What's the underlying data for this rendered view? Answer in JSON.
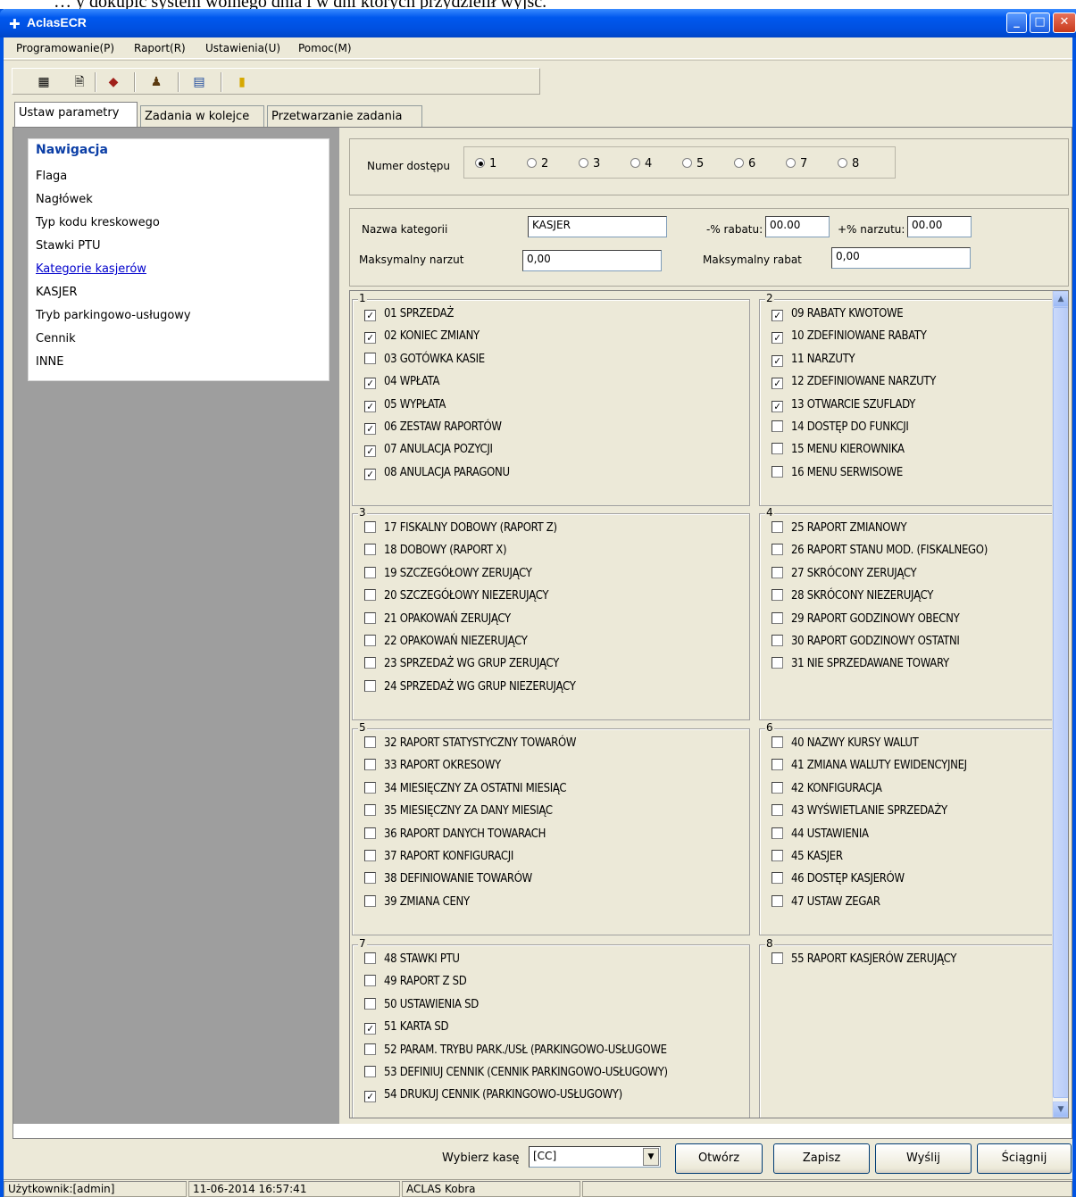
{
  "window": {
    "title": "AclasECR",
    "top_cut_text": "… y dokupić system wolnego dnia i w dni których przydzielił wyjść."
  },
  "menu": [
    "Programowanie(P)",
    "Raport(R)",
    "Ustawienia(U)",
    "Pomoc(M)"
  ],
  "toolbar_icons": [
    "table-icon",
    "document-icon",
    "card-icon",
    "users-icon",
    "settings-icon",
    "exit-door-icon"
  ],
  "tabs": [
    "Ustaw parametry",
    "Zadania w kolejce",
    "Przetwarzanie zadania"
  ],
  "nav": {
    "heading": "Nawigacja",
    "items": [
      "Flaga",
      "Nagłówek",
      "Typ kodu kreskowego",
      "Stawki PTU",
      "Kategorie kasjerów",
      "KASJER",
      "Tryb parkingowo-usługowy",
      "Cennik",
      "INNE"
    ],
    "selected": "Kategorie kasjerów"
  },
  "access": {
    "label": "Numer dostępu",
    "options": [
      "1",
      "2",
      "3",
      "4",
      "5",
      "6",
      "7",
      "8"
    ],
    "selected": "1"
  },
  "category": {
    "name_label": "Nazwa kategorii",
    "name_value": "KASJER",
    "discount_label": "-% rabatu:",
    "discount_value": "00.00",
    "markup_label": "+% narzutu:",
    "markup_value": "00.00",
    "max_markup_label": "Maksymalny narzut",
    "max_markup_value": "0,00",
    "max_discount_label": "Maksymalny rabat",
    "max_discount_value": "0,00"
  },
  "groups": [
    {
      "title": "1",
      "items": [
        {
          "label": "01 SPRZEDAŻ",
          "checked": true
        },
        {
          "label": "02 KONIEC ZMIANY",
          "checked": true
        },
        {
          "label": "03 GOTÓWKA KASIE",
          "checked": false
        },
        {
          "label": "04 WPŁATA",
          "checked": true
        },
        {
          "label": "05 WYPŁATA",
          "checked": true
        },
        {
          "label": "06 ZESTAW RAPORTÓW",
          "checked": true
        },
        {
          "label": "07 ANULACJA POZYCJI",
          "checked": true
        },
        {
          "label": "08 ANULACJA PARAGONU",
          "checked": true
        }
      ]
    },
    {
      "title": "2",
      "items": [
        {
          "label": "09 RABATY KWOTOWE",
          "checked": true
        },
        {
          "label": "10 ZDEFINIOWANE RABATY",
          "checked": true
        },
        {
          "label": "11 NARZUTY",
          "checked": true
        },
        {
          "label": "12 ZDEFINIOWANE NARZUTY",
          "checked": true
        },
        {
          "label": "13 OTWARCIE SZUFLADY",
          "checked": true
        },
        {
          "label": "14 DOSTĘP DO FUNKCJI",
          "checked": false
        },
        {
          "label": "15 MENU KIEROWNIKA",
          "checked": false
        },
        {
          "label": "16 MENU SERWISOWE",
          "checked": false
        }
      ]
    },
    {
      "title": "3",
      "items": [
        {
          "label": "17 FISKALNY DOBOWY (RAPORT Z)",
          "checked": false
        },
        {
          "label": "18 DOBOWY (RAPORT X)",
          "checked": false
        },
        {
          "label": "19 SZCZEGÓŁOWY ZERUJĄCY",
          "checked": false
        },
        {
          "label": "20 SZCZEGÓŁOWY NIEZERUJĄCY",
          "checked": false
        },
        {
          "label": "21 OPAKOWAŃ ZERUJĄCY",
          "checked": false
        },
        {
          "label": "22 OPAKOWAŃ NIEZERUJĄCY",
          "checked": false
        },
        {
          "label": "23 SPRZEDAŻ WG GRUP ZERUJĄCY",
          "checked": false
        },
        {
          "label": "24 SPRZEDAŻ WG GRUP NIEZERUJĄCY",
          "checked": false
        }
      ]
    },
    {
      "title": "4",
      "items": [
        {
          "label": "25 RAPORT ZMIANOWY",
          "checked": false
        },
        {
          "label": "26 RAPORT STANU MOD. (FISKALNEGO)",
          "checked": false
        },
        {
          "label": "27 SKRÓCONY ZERUJĄCY",
          "checked": false
        },
        {
          "label": "28 SKRÓCONY NIEZERUJĄCY",
          "checked": false
        },
        {
          "label": "29 RAPORT GODZINOWY OBECNY",
          "checked": false
        },
        {
          "label": "30 RAPORT GODZINOWY OSTATNI",
          "checked": false
        },
        {
          "label": "31 NIE SPRZEDAWANE TOWARY",
          "checked": false
        }
      ]
    },
    {
      "title": "5",
      "items": [
        {
          "label": "32 RAPORT STATYSTYCZNY TOWARÓW",
          "checked": false
        },
        {
          "label": "33 RAPORT OKRESOWY",
          "checked": false
        },
        {
          "label": "34 MIESIĘCZNY ZA OSTATNI MIESIĄC",
          "checked": false
        },
        {
          "label": "35 MIESIĘCZNY ZA DANY MIESIĄC",
          "checked": false
        },
        {
          "label": "36 RAPORT DANYCH TOWARACH",
          "checked": false
        },
        {
          "label": "37 RAPORT KONFIGURACJI",
          "checked": false
        },
        {
          "label": "38 DEFINIOWANIE TOWARÓW",
          "checked": false
        },
        {
          "label": "39 ZMIANA CENY",
          "checked": false
        }
      ]
    },
    {
      "title": "6",
      "items": [
        {
          "label": "40 NAZWY KURSY WALUT",
          "checked": false
        },
        {
          "label": "41 ZMIANA WALUTY EWIDENCYJNEJ",
          "checked": false
        },
        {
          "label": "42 KONFIGURACJA",
          "checked": false
        },
        {
          "label": "43 WYŚWIETLANIE SPRZEDAŻY",
          "checked": false
        },
        {
          "label": "44 USTAWIENIA",
          "checked": false
        },
        {
          "label": "45 KASJER",
          "checked": false
        },
        {
          "label": "46 DOSTĘP KASJERÓW",
          "checked": false
        },
        {
          "label": "47 USTAW ZEGAR",
          "checked": false
        }
      ]
    },
    {
      "title": "7",
      "items": [
        {
          "label": "48 STAWKI PTU",
          "checked": false
        },
        {
          "label": "49 RAPORT Z SD",
          "checked": false
        },
        {
          "label": "50 USTAWIENIA SD",
          "checked": false
        },
        {
          "label": "51 KARTA SD",
          "checked": true
        },
        {
          "label": "52 PARAM. TRYBU PARK./USŁ (PARKINGOWO-USŁUGOWE",
          "checked": false
        },
        {
          "label": "53 DEFINIUJ CENNIK (CENNIK PARKINGOWO-USŁUGOWY)",
          "checked": false
        },
        {
          "label": "54 DRUKUJ CENNIK (PARKINGOWO-USŁUGOWY)",
          "checked": true
        }
      ]
    },
    {
      "title": "8",
      "items": [
        {
          "label": "55 RAPORT KASJERÓW ZERUJĄCY",
          "checked": false
        }
      ]
    }
  ],
  "actions": {
    "select_label": "Wybierz kasę",
    "select_value": "[CC]",
    "buttons": [
      "Otwórz",
      "Zapisz",
      "Wyślij",
      "Ściągnij"
    ]
  },
  "status": {
    "user": "Użytkownik:[admin]",
    "datetime": "11-06-2014 16:57:41",
    "device": "ACLAS Kobra"
  }
}
